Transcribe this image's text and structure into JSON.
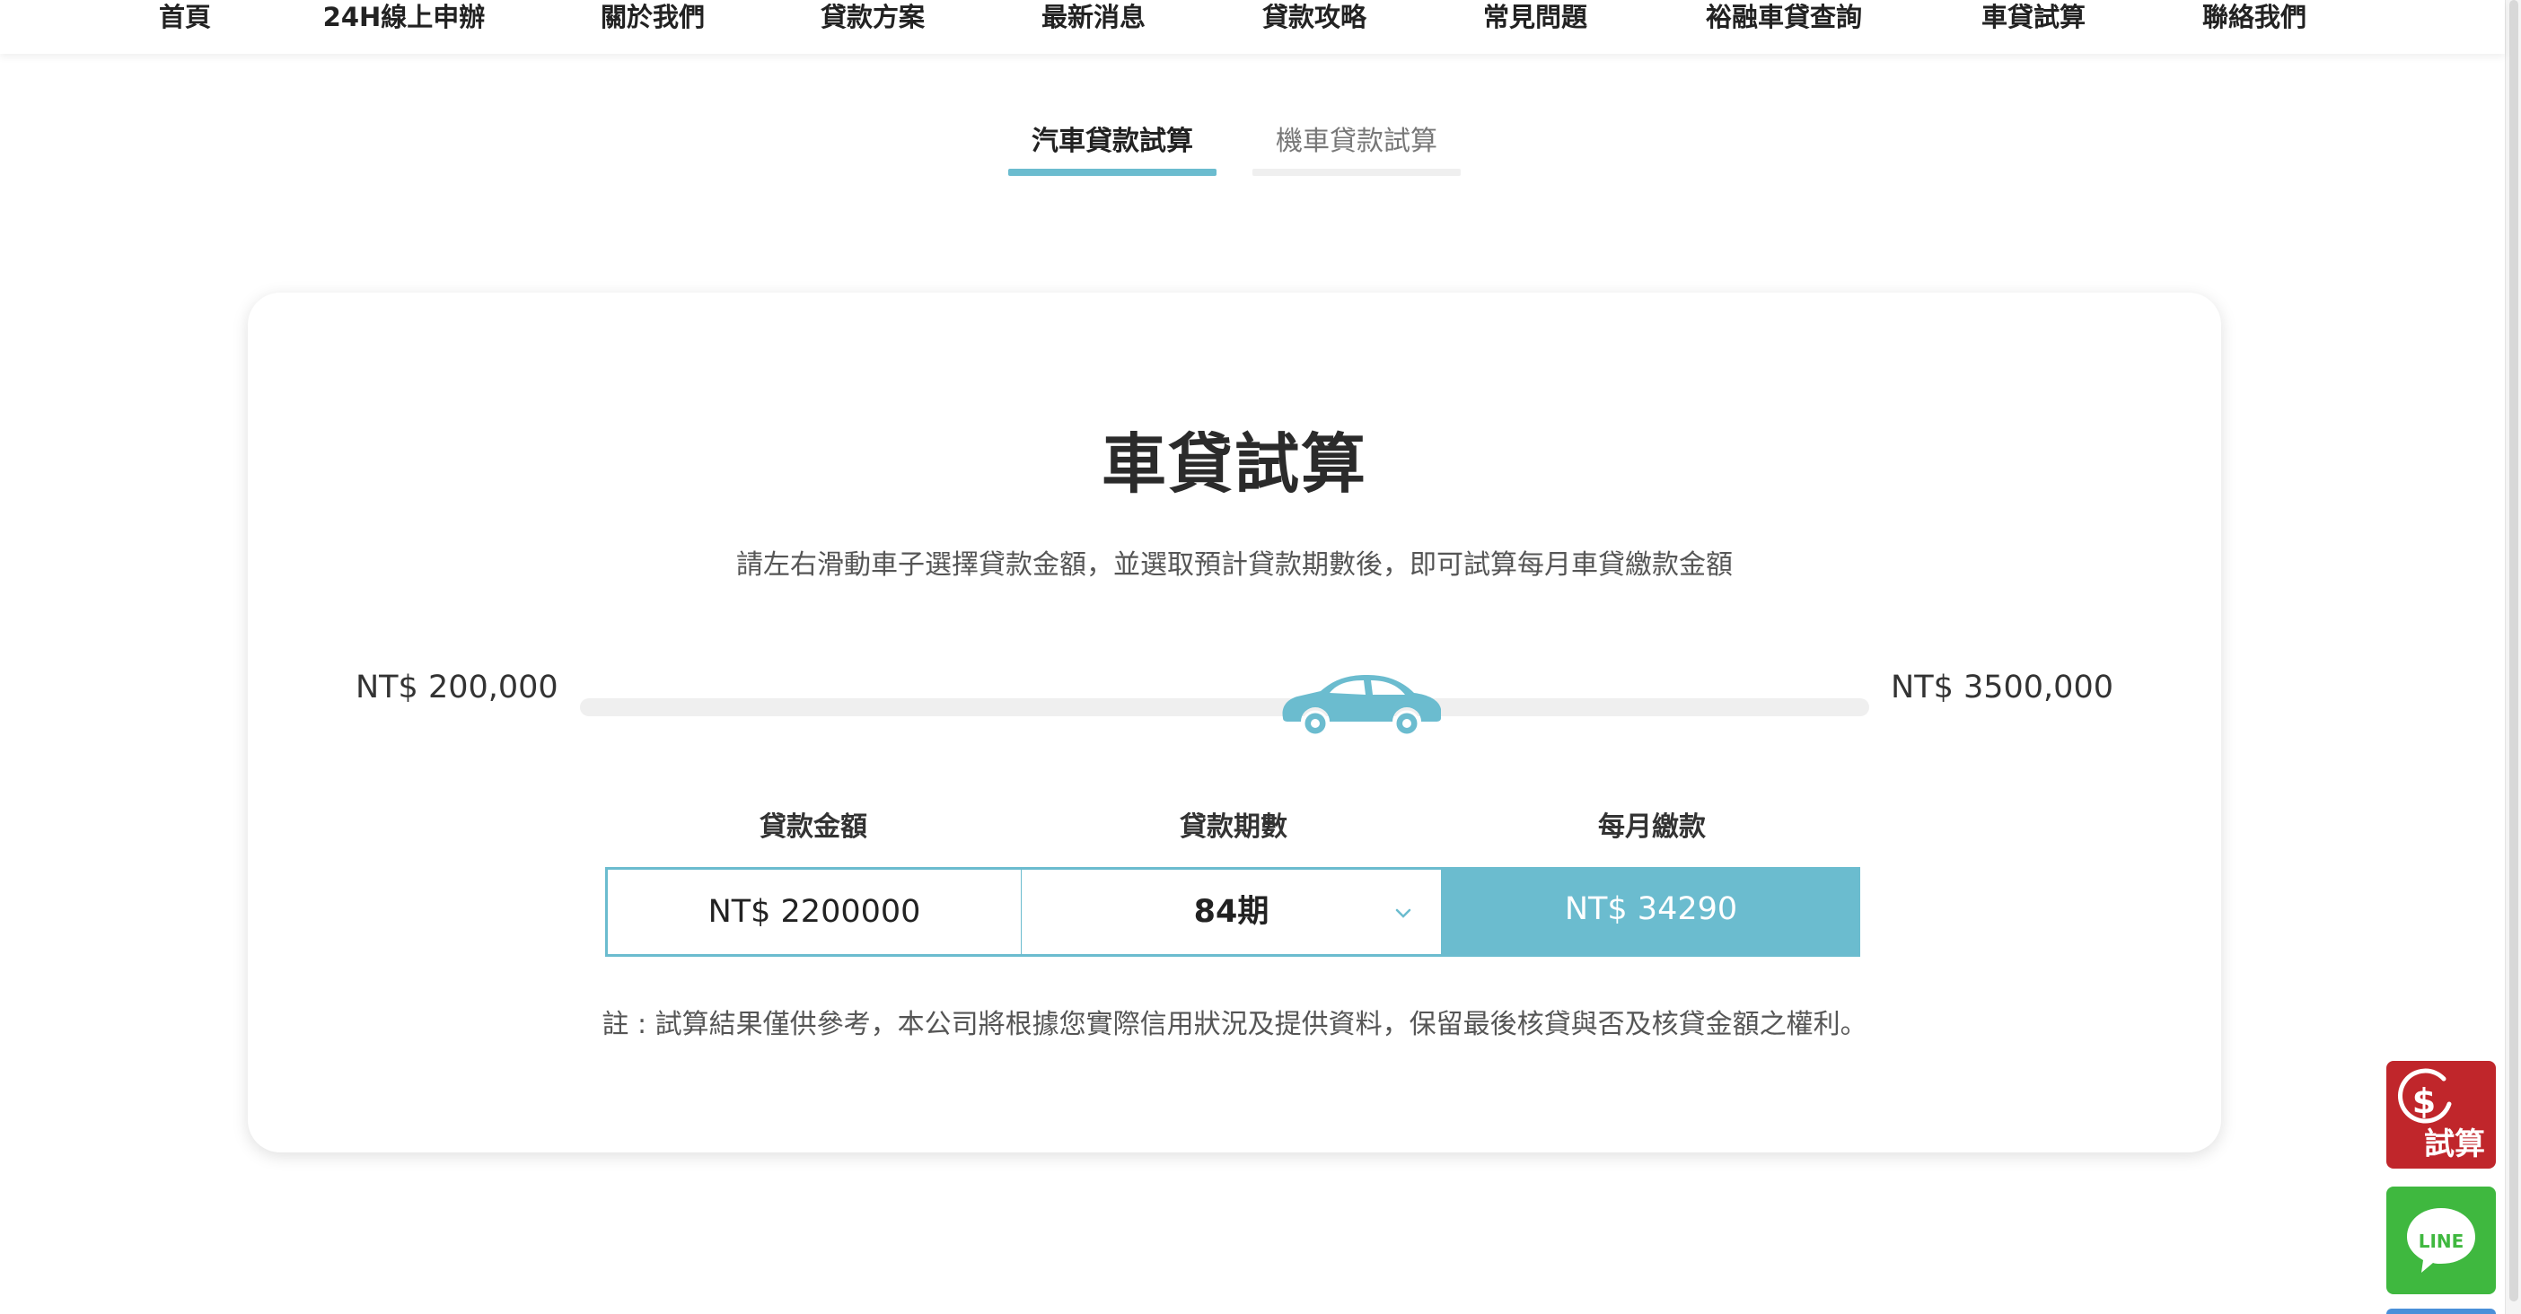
{
  "nav": {
    "items": [
      "首頁",
      "24H線上申辦",
      "關於我們",
      "貸款方案",
      "最新消息",
      "貸款攻略",
      "常見問題",
      "裕融車貸查詢",
      "車貸試算",
      "聯絡我們"
    ]
  },
  "tabs": [
    {
      "label": "汽車貸款試算",
      "active": true
    },
    {
      "label": "機車貸款試算",
      "active": false
    }
  ],
  "calculator": {
    "title": "車貸試算",
    "subtitle": "請左右滑動車子選擇貸款金額，並選取預計貸款期數後，即可試算每月車貸繳款金額",
    "slider": {
      "min_label": "NT$ 200,000",
      "max_label": "NT$ 3500,000",
      "min_value": 200000,
      "max_value": 3500000,
      "value": 2200000
    },
    "fields": {
      "amount_label": "貸款金額",
      "amount_value": "NT$ 2200000",
      "term_label": "貸款期數",
      "term_value": "84期",
      "monthly_label": "每月繳款",
      "monthly_value": "NT$ 34290"
    },
    "note": "註 : 試算結果僅供參考，本公司將根據您實際信用狀況及提供資料，保留最後核貸與否及核貸金額之權利。"
  },
  "floating": {
    "calc_label": "試算",
    "calc_icon": "dollar-circle-icon",
    "line_label": "LINE",
    "line_icon": "line-chat-icon"
  },
  "colors": {
    "accent": "#6bbccf",
    "calc_red": "#c0262b",
    "line_green": "#3fb83f",
    "tab_inactive": "#efefef"
  }
}
